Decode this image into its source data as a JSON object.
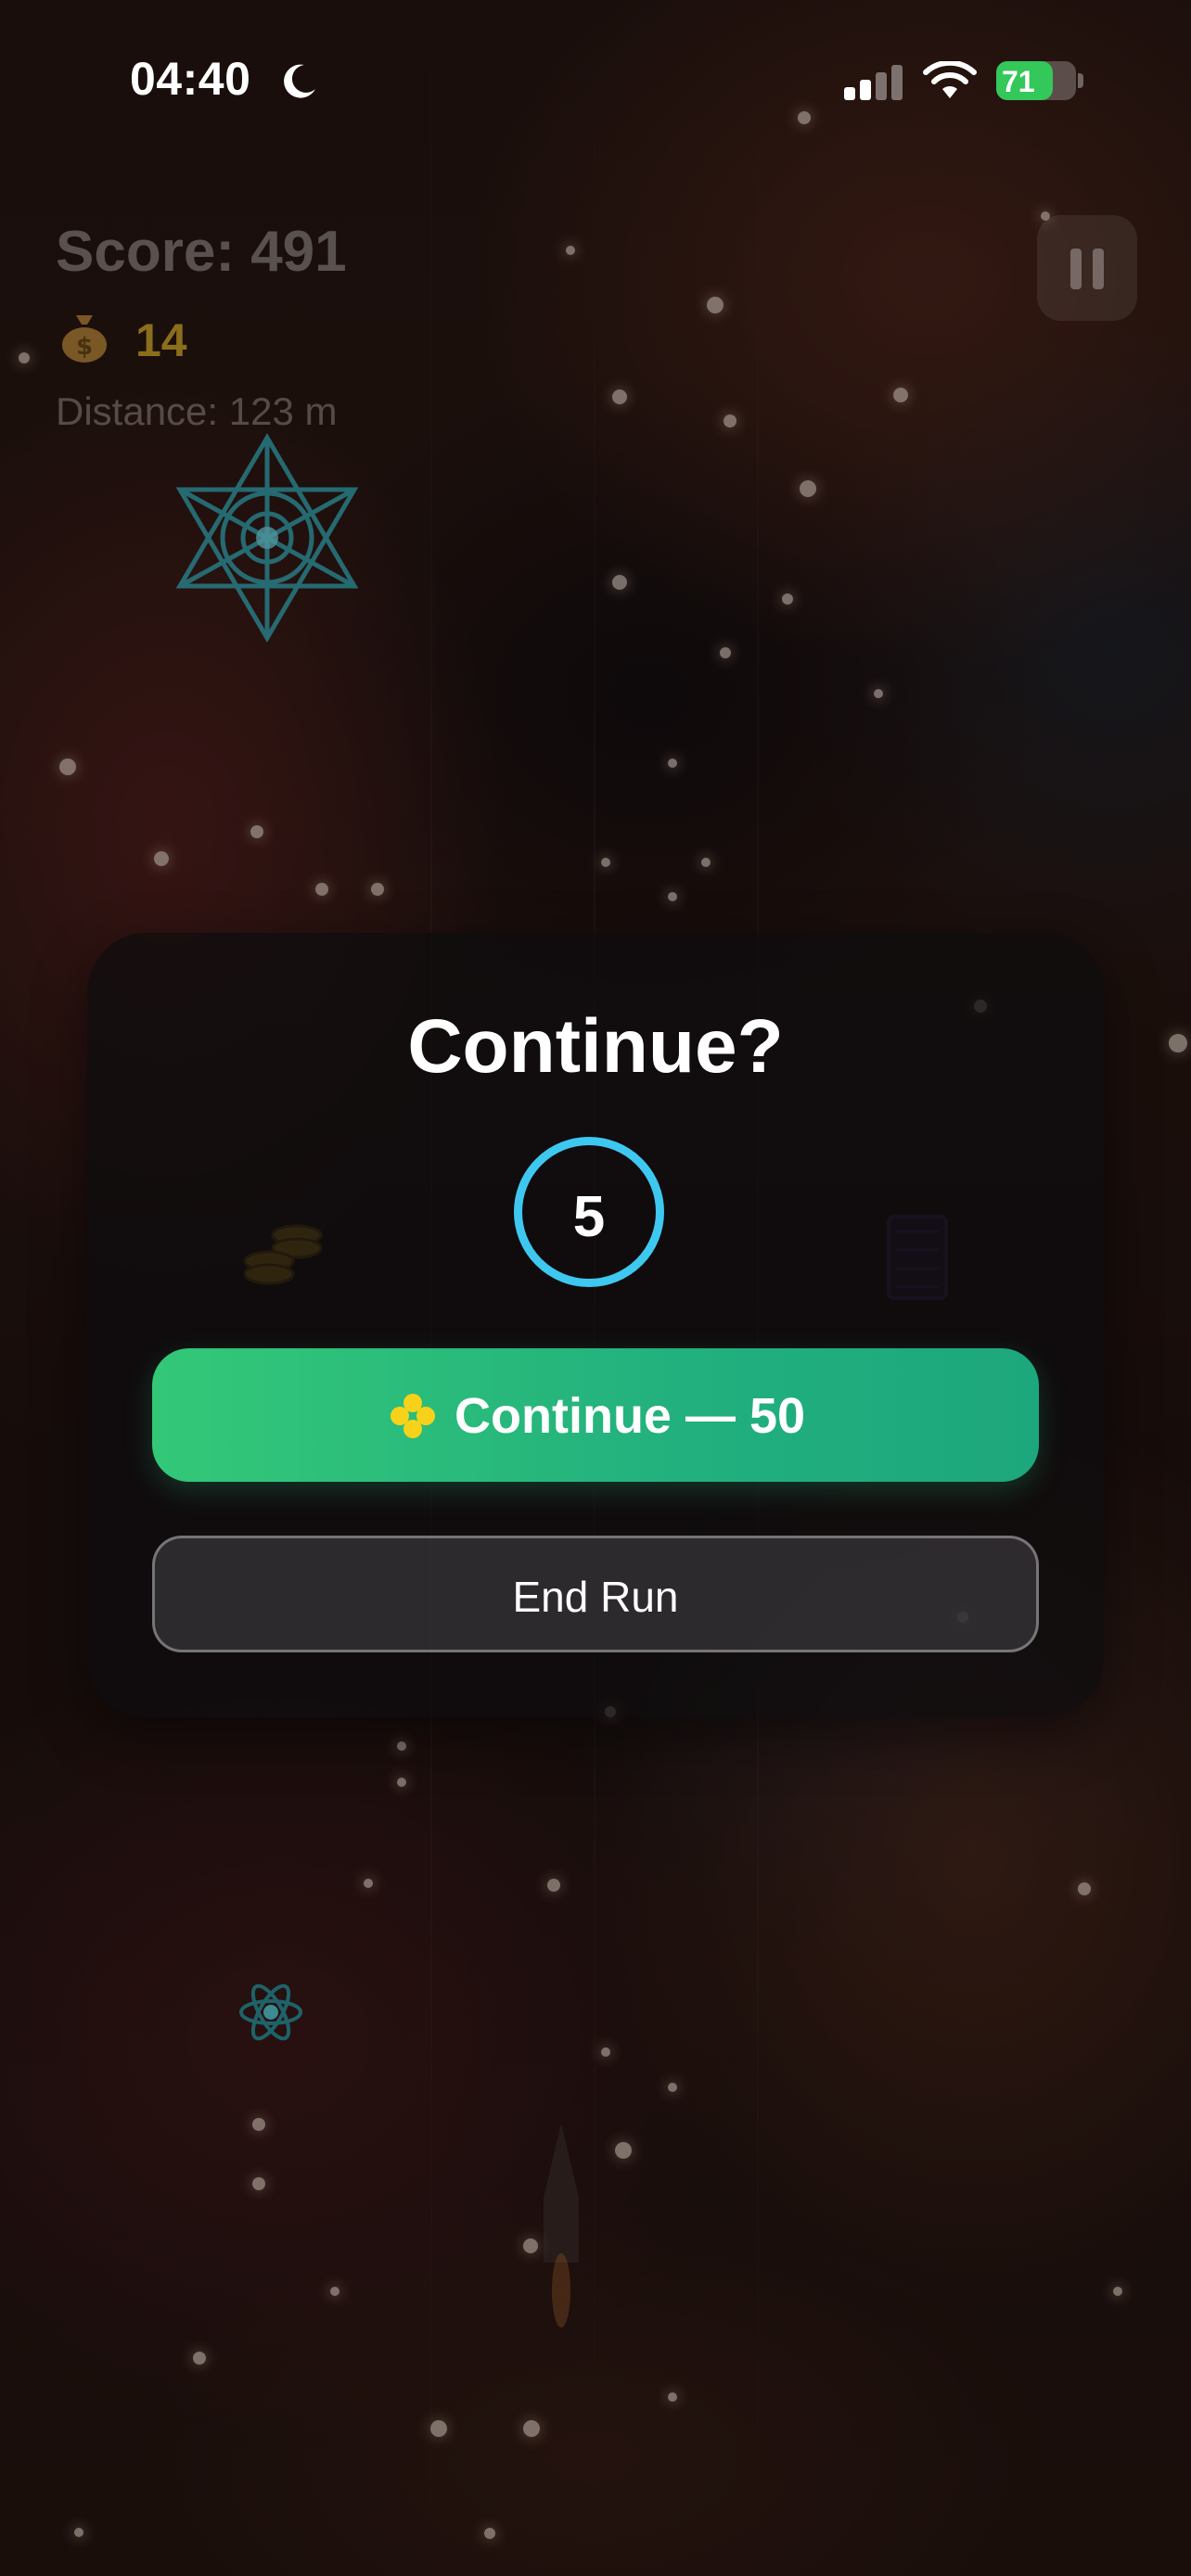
{
  "status_bar": {
    "time": "04:40",
    "battery_level": "71",
    "focus_icon": "moon-icon",
    "signal_icon": "cellular-signal-icon",
    "wifi_icon": "wifi-icon",
    "battery_icon": "battery-charging-icon"
  },
  "hud": {
    "score_text": "Score: 491",
    "coins": "14",
    "coin_icon": "money-bag-icon",
    "distance_text": "Distance: 123 m",
    "pause_icon": "pause-icon"
  },
  "modal": {
    "title": "Continue?",
    "countdown": "5",
    "continue_label": "Continue — 50",
    "continue_icon": "gem-currency-icon",
    "end_label": "End Run"
  },
  "colors": {
    "continue_green": "#22b07e",
    "countdown_ring": "#3ec8f0",
    "coin_gold": "#e8be28",
    "battery_green": "#34c759"
  }
}
